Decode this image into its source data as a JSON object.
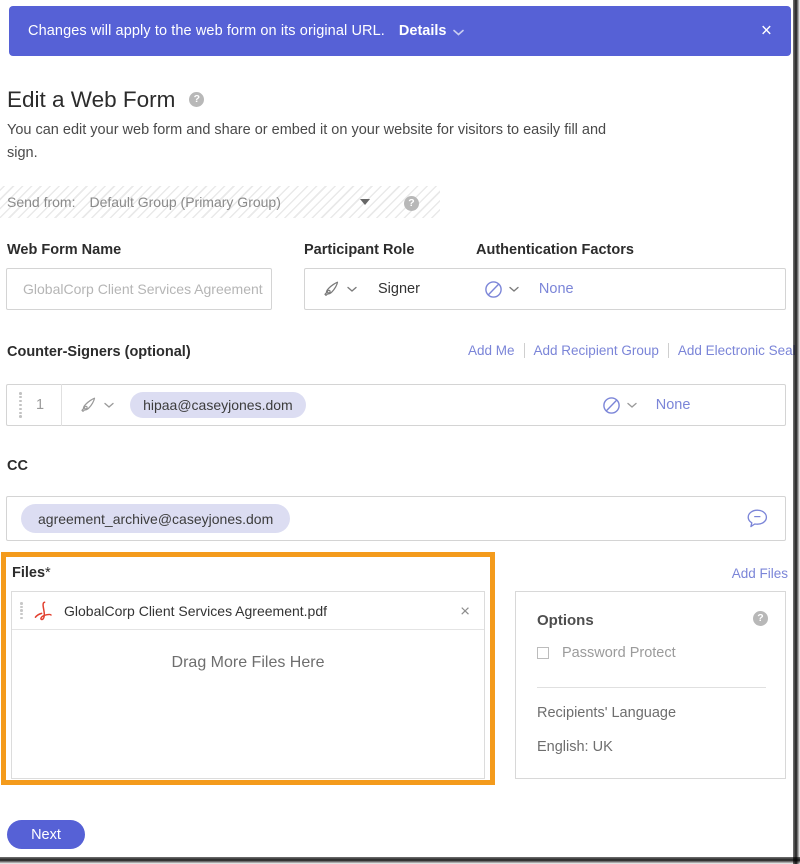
{
  "banner": {
    "message": "Changes will apply to the web form on its original URL.",
    "details_label": "Details",
    "close_label": "×",
    "background_color": "#5661d6"
  },
  "header": {
    "title": "Edit a Web Form",
    "help_icon_label": "?",
    "subtitle": "You can edit your web form and share or embed it on your website for visitors to easily fill and sign."
  },
  "send_from": {
    "label": "Send from:",
    "value": "Default Group (Primary Group)",
    "help_icon_label": "?"
  },
  "web_form_name": {
    "label": "Web Form Name",
    "placeholder": "GlobalCorp Client Services Agreement",
    "value": ""
  },
  "participant_role": {
    "label": "Participant Role",
    "role_value": "Signer",
    "role_icon": "pen-nib-icon"
  },
  "authentication_factors": {
    "label": "Authentication Factors",
    "value": "None",
    "icon": "circle-slash-icon",
    "value_color": "#7b85d8"
  },
  "counter_signers": {
    "label": "Counter-Signers (optional)",
    "links": [
      {
        "label": "Add Me"
      },
      {
        "label": "Add Recipient Group"
      },
      {
        "label": "Add Electronic Seal"
      }
    ],
    "rows": [
      {
        "index": "1",
        "role_icon": "pen-nib-icon",
        "email": "hipaa@caseyjones.dom",
        "auth_icon": "circle-slash-icon",
        "auth_value": "None"
      }
    ]
  },
  "cc": {
    "label": "CC",
    "email": "agreement_archive@caseyjones.dom",
    "bubble_icon": "message-bubble-icon"
  },
  "files": {
    "label": "Files",
    "required_marker": "*",
    "add_files_label": "Add Files",
    "items": [
      {
        "name": "GlobalCorp Client Services Agreement.pdf",
        "icon": "pdf-icon",
        "remove_label": "×"
      }
    ],
    "drop_zone_text": "Drag More Files Here",
    "highlight_color": "#f49b1c"
  },
  "options": {
    "title": "Options",
    "help_icon_label": "?",
    "password_protect": {
      "label": "Password Protect",
      "checked": false
    },
    "language": {
      "label": "Recipients' Language",
      "value": "English: UK"
    }
  },
  "footer": {
    "next_label": "Next"
  }
}
